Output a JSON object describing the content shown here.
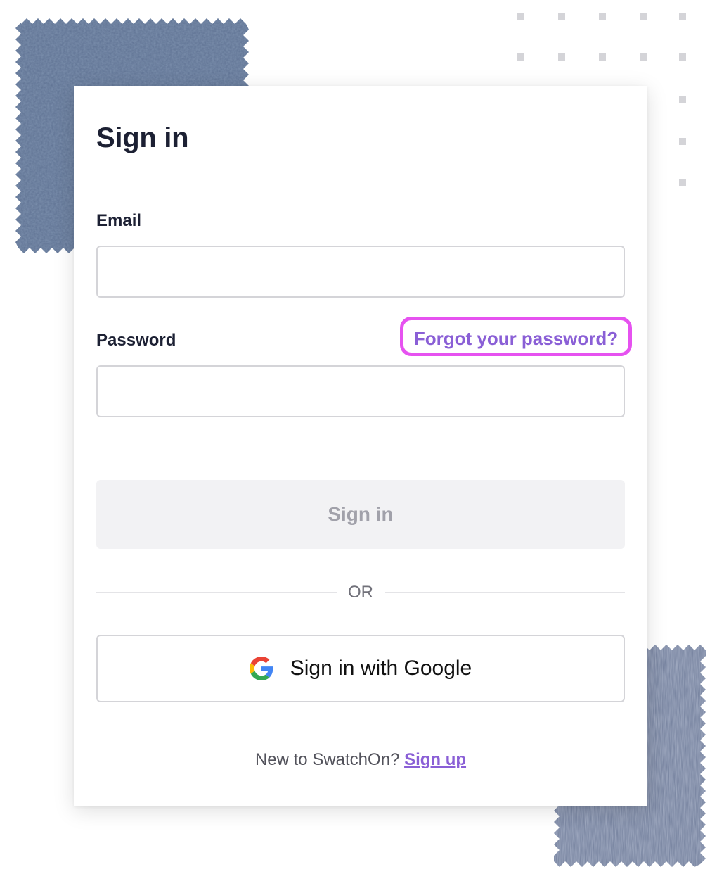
{
  "page": {
    "title": "Sign in"
  },
  "form": {
    "email_label": "Email",
    "email_value": "",
    "password_label": "Password",
    "password_value": "",
    "forgot_password_link": "Forgot your password?",
    "submit_label": "Sign in",
    "divider_text": "OR",
    "google_button_label": "Sign in with Google"
  },
  "footer": {
    "prompt": "New to SwatchOn?",
    "signup_link": "Sign up"
  },
  "colors": {
    "accent": "#8a5fd6",
    "highlight_ring": "#e652f0",
    "heading": "#1c2033",
    "disabled_button_bg": "#f2f2f4",
    "disabled_button_text": "#a1a1aa"
  },
  "icons": [
    "google-icon"
  ]
}
